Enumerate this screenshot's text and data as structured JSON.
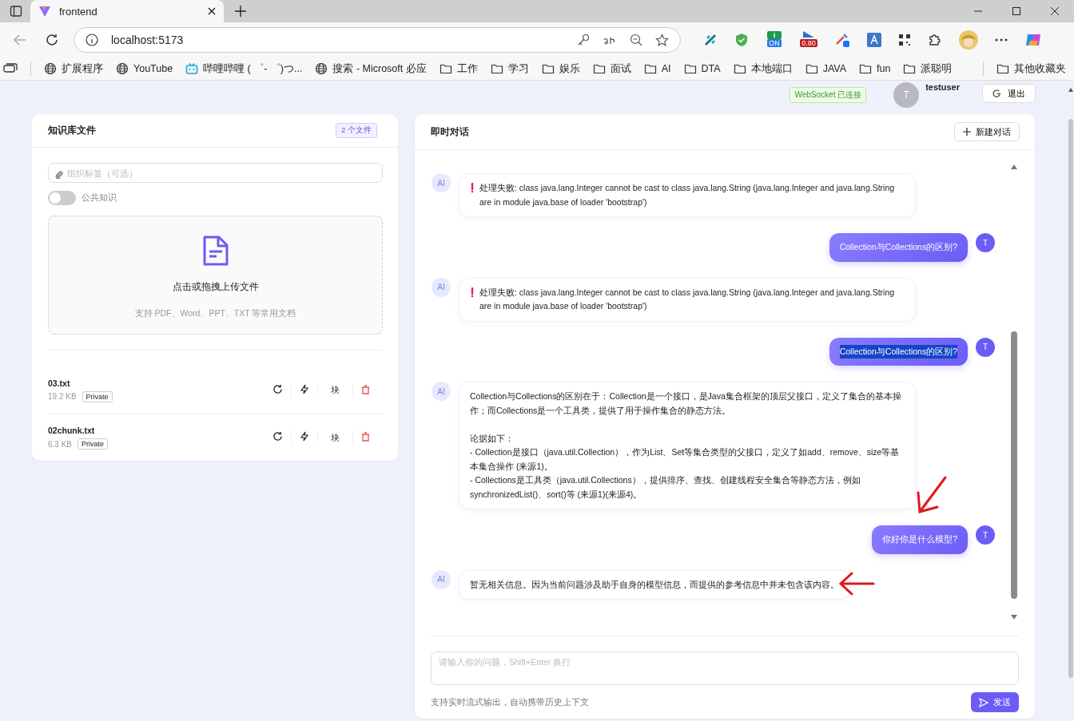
{
  "browser": {
    "tab": {
      "title": "frontend"
    },
    "address": "localhost:5173",
    "extension_badges": [
      "ON",
      "0.80"
    ],
    "bookmarks": [
      {
        "label": "扩展程序",
        "kind": "globe"
      },
      {
        "label": "YouTube",
        "kind": "globe"
      },
      {
        "label": "哔哩哔哩 ( ゜- ゜)つ...",
        "kind": "tv"
      },
      {
        "label": "搜索 - Microsoft 必应",
        "kind": "globe"
      },
      {
        "label": "工作",
        "kind": "folder"
      },
      {
        "label": "学习",
        "kind": "folder"
      },
      {
        "label": "娱乐",
        "kind": "folder"
      },
      {
        "label": "面试",
        "kind": "folder"
      },
      {
        "label": "AI",
        "kind": "folder"
      },
      {
        "label": "DTA",
        "kind": "folder"
      },
      {
        "label": "本地端口",
        "kind": "folder"
      },
      {
        "label": "JAVA",
        "kind": "folder"
      },
      {
        "label": "fun",
        "kind": "folder"
      },
      {
        "label": "派聪明",
        "kind": "folder"
      }
    ],
    "other_bookmarks": "其他收藏夹"
  },
  "header": {
    "status": "WebSocket 已连接",
    "avatar": "T",
    "username": "testuser",
    "logout": "退出"
  },
  "files_panel": {
    "title": "知识库文件",
    "count": "2 个文件",
    "tag_field": {
      "placeholder": "组织标签（可选）"
    },
    "public_toggle": {
      "label": "公共知识",
      "on": false
    },
    "upload": {
      "title": "点击或拖拽上传文件",
      "hint": "支持 PDF、Word、PPT、TXT 等常用文档"
    },
    "files": [
      {
        "name": "03.txt",
        "size": "19.2 KB",
        "visibility": "Private",
        "chunk_action": "块"
      },
      {
        "name": "02chunk.txt",
        "size": "6.3 KB",
        "visibility": "Private",
        "chunk_action": "块"
      }
    ]
  },
  "chat": {
    "title": "即时对话",
    "new_button": "新建对话",
    "messages": [
      {
        "kind": "error",
        "avatar": "AI",
        "paragraphs": [
          "处理失败: class java.lang.Integer cannot be cast to class java.lang.String (java.lang.Integer and java.lang.String are in module java.base of loader 'bootstrap')"
        ],
        "text_highlighted": false
      },
      {
        "kind": "question",
        "avatar": "T",
        "paragraphs": [
          "Collection与Collections的区别?"
        ],
        "text_highlighted": false
      },
      {
        "kind": "error",
        "avatar": "AI",
        "paragraphs": [
          "处理失败: class java.lang.Integer cannot be cast to class java.lang.String (java.lang.Integer and java.lang.String are in module java.base of loader 'bootstrap')"
        ],
        "text_highlighted": false
      },
      {
        "kind": "question",
        "avatar": "T",
        "paragraphs": [
          "Collection与Collections的区别?"
        ],
        "text_highlighted": true
      },
      {
        "kind": "answer",
        "avatar": "AI",
        "paragraphs": [
          "Collection与Collections的区别在于：Collection是一个接口，是Java集合框架的顶层父接口，定义了集合的基本操作；而Collections是一个工具类，提供了用于操作集合的静态方法。",
          "论据如下：",
          "- Collection是接口（java.util.Collection），作为List、Set等集合类型的父接口，定义了如add、remove、size等基本集合操作 (来源1)。",
          "- Collections是工具类（java.util.Collections），提供排序、查找、创建线程安全集合等静态方法，例如synchronizedList()、sort()等 (来源1)(来源4)。"
        ],
        "text_highlighted": false
      },
      {
        "kind": "question",
        "avatar": "T",
        "paragraphs": [
          "你好你是什么模型?"
        ],
        "text_highlighted": false
      },
      {
        "kind": "answer",
        "avatar": "AI",
        "paragraphs": [
          "暂无相关信息。因为当前问题涉及助手自身的模型信息，而提供的参考信息中并未包含该内容。"
        ],
        "text_highlighted": false
      }
    ],
    "input": {
      "placeholder": "请输入你的问题，Shift+Enter 换行"
    },
    "hint": "支持实时流式输出，自动携带历史上下文",
    "send_button": "发送"
  }
}
